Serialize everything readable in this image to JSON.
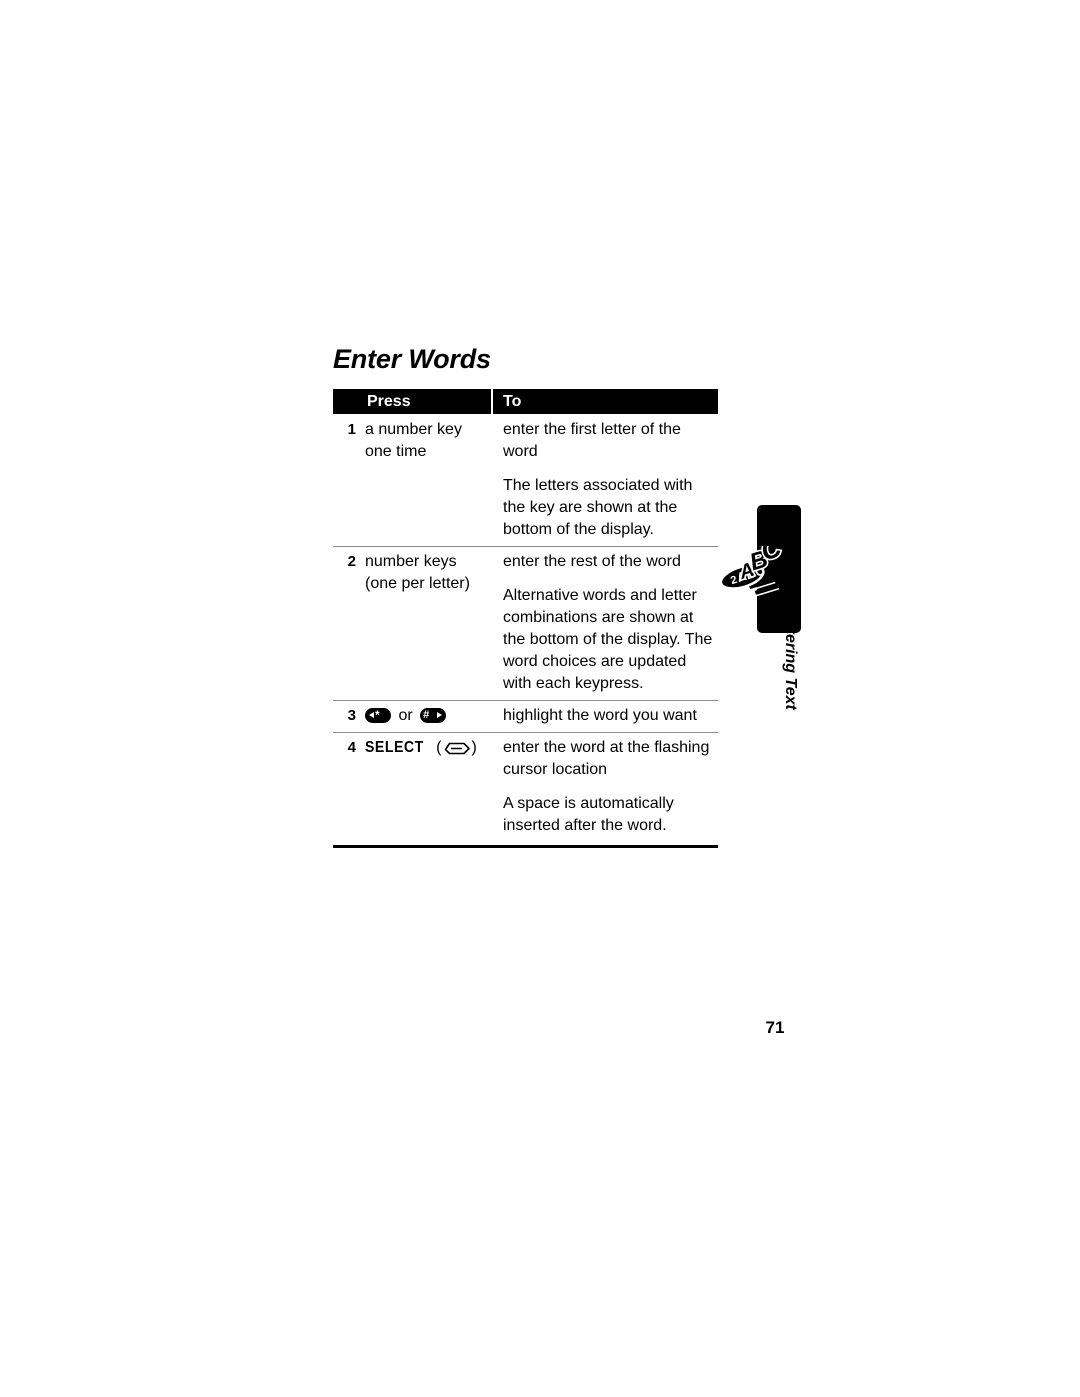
{
  "page": {
    "title": "Enter Words",
    "folio": "71"
  },
  "table": {
    "columns": {
      "num": "",
      "press": "Press",
      "to": "To"
    },
    "rows": [
      {
        "num": "1",
        "press_lines": [
          "a number key",
          "one time"
        ],
        "to_paragraphs": [
          "enter the first letter of the word",
          "The letters associated with the key are shown at the bottom of the display."
        ]
      },
      {
        "num": "2",
        "press_lines": [
          "number keys",
          "(one per letter)"
        ],
        "to_paragraphs": [
          "enter the rest of the word",
          "Alternative words and letter combinations are shown at the bottom of the display. The word choices are updated with each keypress."
        ]
      },
      {
        "num": "3",
        "press_keys": {
          "left_icon": "star-left-nav-key-icon",
          "left_symbol": "*",
          "conjunction": "or",
          "right_icon": "hash-right-nav-key-icon",
          "right_symbol": "#"
        },
        "to_paragraphs": [
          "highlight the word you want"
        ]
      },
      {
        "num": "4",
        "press_label": "SELECT",
        "press_key_icon": "center-select-key-icon",
        "to_paragraphs": [
          "enter the word at the flashing cursor location",
          "A space is automatically inserted after the word."
        ]
      }
    ]
  },
  "side_tab": {
    "caption": "Entering Text",
    "logo_text": "2ABC",
    "logo_icon": "keypad-2abc-logo"
  },
  "colors": {
    "header_bg": "#000000",
    "header_text": "#ffffff",
    "body_text": "#000000",
    "rule": "#8b8b8b",
    "tab_bg": "#000000"
  }
}
